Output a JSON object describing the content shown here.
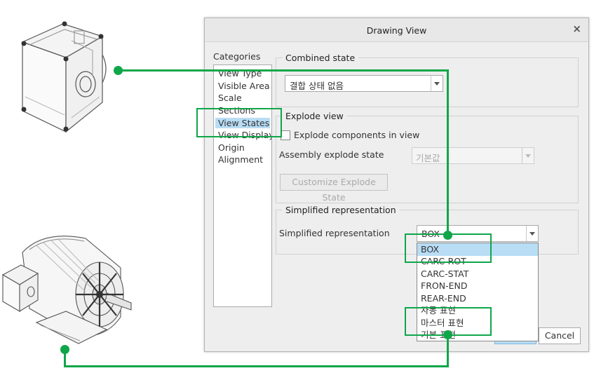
{
  "dialog": {
    "title": "Drawing View",
    "close_glyph": "×",
    "categories_label": "Categories",
    "categories": [
      "View Type",
      "Visible Area",
      "Scale",
      "Sections",
      "View States",
      "View Display",
      "Origin",
      "Alignment"
    ],
    "selected_category": "View States",
    "combined_state": {
      "group_title": "Combined state",
      "value": "결합 상태 없음"
    },
    "explode_view": {
      "group_title": "Explode view",
      "checkbox_label": "Explode components in view",
      "checked": false,
      "assembly_label": "Assembly explode state",
      "assembly_value": "기본값",
      "customize_button": "Customize Explode State"
    },
    "simplified": {
      "group_title": "Simplified representation",
      "label": "Simplified representation",
      "value": "BOX",
      "options": [
        "BOX",
        "CARC-ROT",
        "CARC-STAT",
        "FRON-END",
        "REAR-END",
        "자동 표현",
        "마스터 표현",
        "기본 표현"
      ],
      "highlighted": "BOX"
    },
    "cancel_button": "Cancel"
  },
  "colors": {
    "annotation_green": "#0fa64a",
    "selection_blue": "#b8ddf5",
    "dialog_bg": "#eeeeee"
  },
  "icons": {
    "close": "close-icon",
    "dropdown": "chevron-down-icon",
    "top_model": "junction-box-model-icon",
    "bottom_model": "electric-motor-model-icon"
  }
}
